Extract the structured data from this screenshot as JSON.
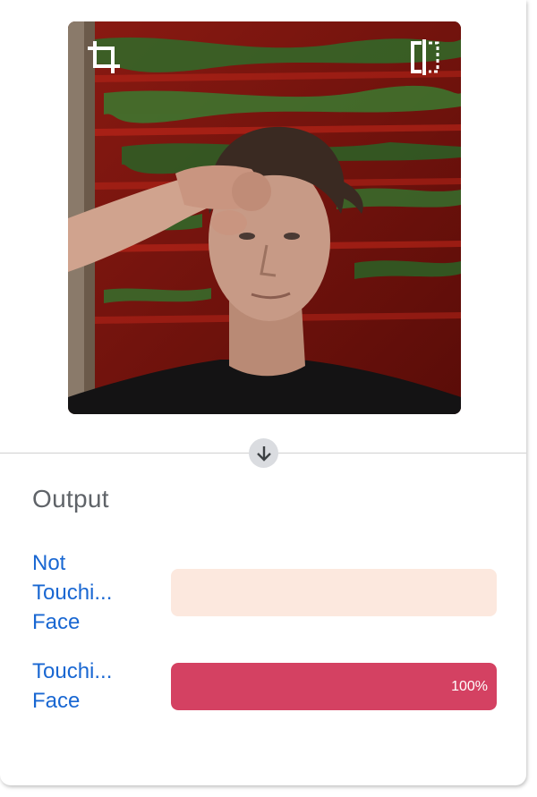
{
  "webcam": {
    "crop_icon": "crop-icon",
    "flip_icon": "flip-icon"
  },
  "divider": {
    "arrow_icon": "arrow-down-icon"
  },
  "output": {
    "title": "Output",
    "classes": [
      {
        "label_lines": [
          "Not",
          "Touchi...",
          "Face"
        ],
        "confidence": 0,
        "percent_text": "",
        "track_color": "#fce8de",
        "fill_color": "#fce8de"
      },
      {
        "label_lines": [
          "Touchi...",
          "Face"
        ],
        "confidence": 1.0,
        "percent_text": "100%",
        "track_color": "#fce8de",
        "fill_color": "#d44162"
      }
    ]
  }
}
